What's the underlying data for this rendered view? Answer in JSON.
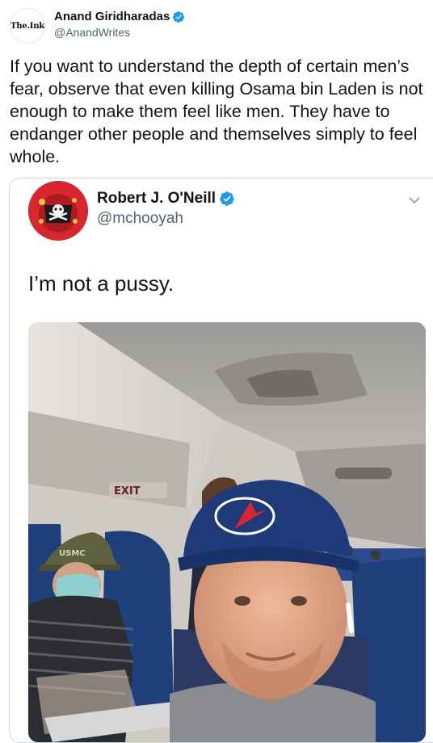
{
  "tweet": {
    "author": {
      "avatar_text": "The.Ink",
      "display_name": "Anand Giridharadas",
      "handle": "@AnandWrites",
      "verified": true
    },
    "text": "If you want to understand the depth of certain men’s fear, observe that even killing Osama bin Laden is not enough to make them feel like men. They have to endanger other people and themselves simply to feel whole."
  },
  "quoted_tweet": {
    "author": {
      "display_name": "Robert J. O'Neill",
      "handle": "@mchooyah",
      "verified": true
    },
    "text": "I’m not a pussy.",
    "photo": {
      "exit_sign": "EXIT",
      "cap_text": "USMC"
    }
  },
  "colors": {
    "verified_badge": "#1d9bf0",
    "handle_gray": "#536471",
    "border": "#cfd9de",
    "seat_blue": "#1e3f7a"
  },
  "icons": [
    "verified-badge-icon",
    "chevron-down-icon"
  ]
}
